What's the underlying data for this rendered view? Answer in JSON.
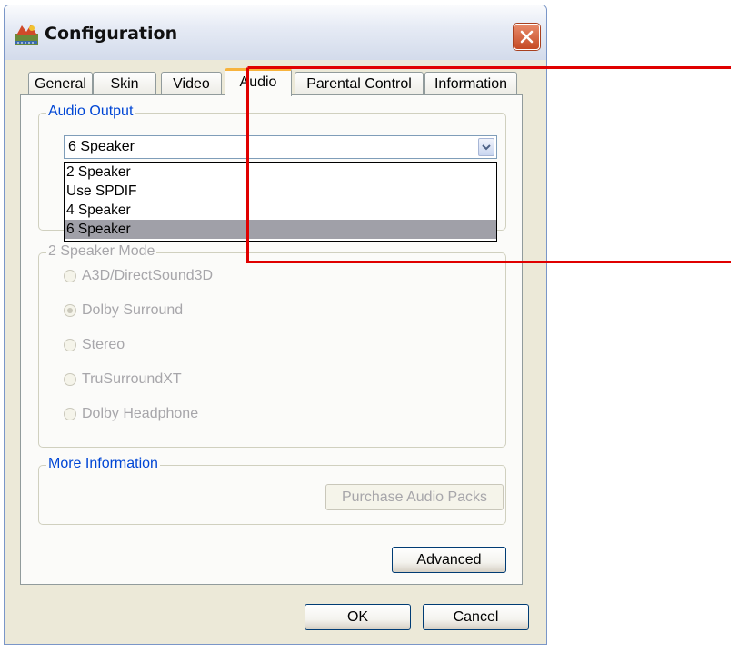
{
  "window": {
    "title": "Configuration",
    "icon": "configuration-app-icon",
    "close_icon": "close-icon"
  },
  "tabs": [
    {
      "label": "General",
      "active": false
    },
    {
      "label": "Skin",
      "active": false
    },
    {
      "label": "Video",
      "active": false
    },
    {
      "label": "Audio",
      "active": true
    },
    {
      "label": "Parental Control",
      "active": false
    },
    {
      "label": "Information",
      "active": false
    }
  ],
  "audio_output": {
    "group_label": "Audio Output",
    "selected_value": "6 Speaker",
    "options": [
      "2 Speaker",
      "Use SPDIF",
      "4 Speaker",
      "6 Speaker"
    ],
    "highlighted_option": "6 Speaker"
  },
  "speaker_mode": {
    "group_label": "2 Speaker Mode",
    "enabled": false,
    "options": [
      {
        "label": "A3D/DirectSound3D",
        "checked": false
      },
      {
        "label": "Dolby Surround",
        "checked": true
      },
      {
        "label": "Stereo",
        "checked": false
      },
      {
        "label": "TruSurroundXT",
        "checked": false
      },
      {
        "label": "Dolby Headphone",
        "checked": false
      }
    ]
  },
  "more_info": {
    "group_label": "More Information",
    "purchase_button": "Purchase Audio Packs"
  },
  "buttons": {
    "advanced": "Advanced",
    "ok": "OK",
    "cancel": "Cancel"
  },
  "colors": {
    "annotation": "#e00000",
    "group_label": "#0046d5",
    "disabled_text": "#a7a6aa",
    "tab_active_accent": "#f7b33d"
  }
}
